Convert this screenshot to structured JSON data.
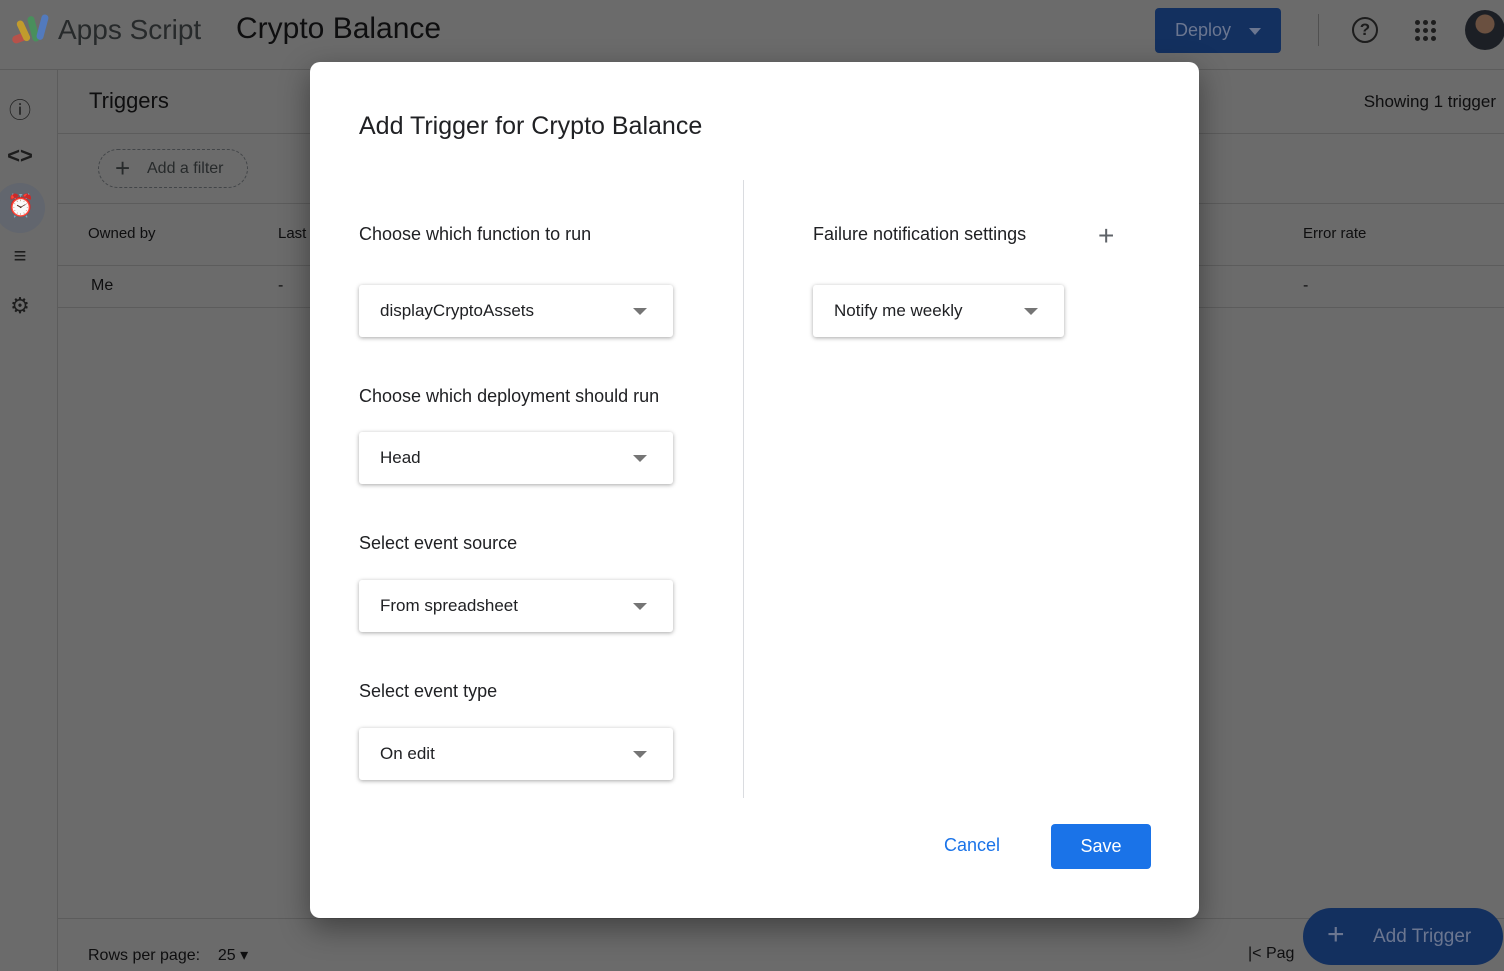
{
  "header": {
    "app_name": "Apps Script",
    "project_name": "Crypto Balance",
    "deploy_label": "Deploy"
  },
  "page": {
    "title": "Triggers",
    "showing": "Showing 1 trigger",
    "add_filter": "Add a filter",
    "columns": [
      "Owned by",
      "Last",
      "Error rate"
    ],
    "row": {
      "owner": "Me",
      "last": "-",
      "error_rate": "-"
    },
    "rows_per_page_label": "Rows per page:",
    "rows_per_page": "25",
    "page_label": "Pag",
    "add_trigger": "Add Trigger"
  },
  "dialog": {
    "title": "Add Trigger for Crypto Balance",
    "function_label": "Choose which function to run",
    "function_value": "displayCryptoAssets",
    "deployment_label": "Choose which deployment should run",
    "deployment_value": "Head",
    "source_label": "Select event source",
    "source_value": "From spreadsheet",
    "type_label": "Select event type",
    "type_value": "On edit",
    "failure_label": "Failure notification settings",
    "failure_value": "Notify me weekly",
    "cancel": "Cancel",
    "save": "Save"
  },
  "colors": {
    "primary": "#1a73e8",
    "scrim": "rgba(0,0,0,0.58)"
  }
}
